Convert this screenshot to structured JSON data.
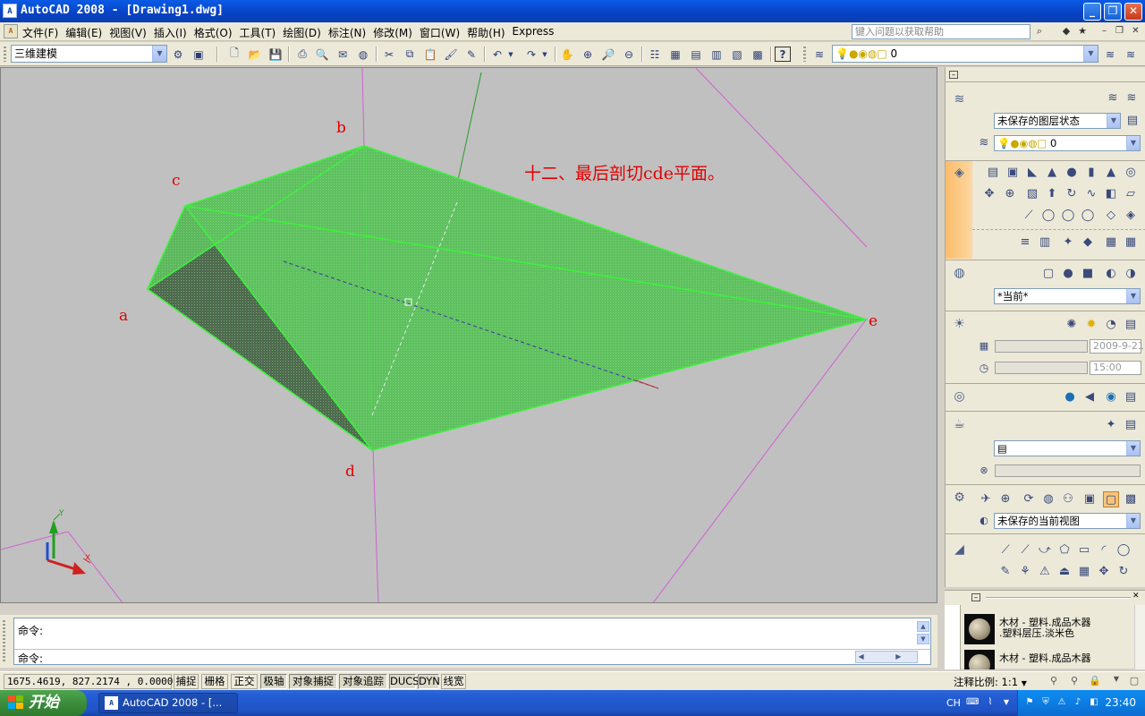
{
  "window": {
    "title": "AutoCAD 2008 - [Drawing1.dwg]",
    "app_icon": "autocad-icon",
    "minimize": "_",
    "maximize": "❐",
    "close": "✕"
  },
  "menu": {
    "items": [
      "文件(F)",
      "编辑(E)",
      "视图(V)",
      "插入(I)",
      "格式(O)",
      "工具(T)",
      "绘图(D)",
      "标注(N)",
      "修改(M)",
      "窗口(W)",
      "帮助(H)",
      "Express"
    ],
    "search_placeholder": "键入问题以获取帮助"
  },
  "toolbar": {
    "workspace": "三维建模",
    "layer_value": "0"
  },
  "viewport": {
    "caption": "十二、最后剖切cde平面。",
    "vertex_labels": [
      "a",
      "b",
      "c",
      "d",
      "e"
    ],
    "ucs_y": "Y",
    "ucs_x": "X",
    "colors": {
      "background": "#c0c0c0",
      "solid": "#66cc66",
      "edges": "#3ef03e",
      "label": "#e00000",
      "magenta": "#d060d0"
    }
  },
  "command": {
    "line1": "命令:",
    "line2": "命令:"
  },
  "status": {
    "coordinates": "1675.4619, 827.2174 , 0.0000",
    "toggles": [
      "捕捉",
      "栅格",
      "正交",
      "极轴",
      "对象捕捉",
      "对象追踪",
      "DUCS",
      "DYN",
      "线宽"
    ],
    "annotation_scale_label": "注释比例: ",
    "annotation_scale_value": "1:1"
  },
  "palette": {
    "layer_state": "未保存的图层状态",
    "layer_value": "0",
    "visual_style": "*当前*",
    "date": "2009-9-21",
    "time": "15:00",
    "light_select": "",
    "view_select": "未保存的当前视图"
  },
  "materials": {
    "items": [
      {
        "line1": "木材 - 塑料.成品木器",
        "line2": ".塑料层压.淡米色"
      },
      {
        "line1": "木材 - 塑料.成品木器",
        "line2": ""
      }
    ]
  },
  "taskbar": {
    "start_label": "开始",
    "task_label": "AutoCAD 2008 - [...",
    "lang": "CH",
    "clock": "23:40"
  }
}
